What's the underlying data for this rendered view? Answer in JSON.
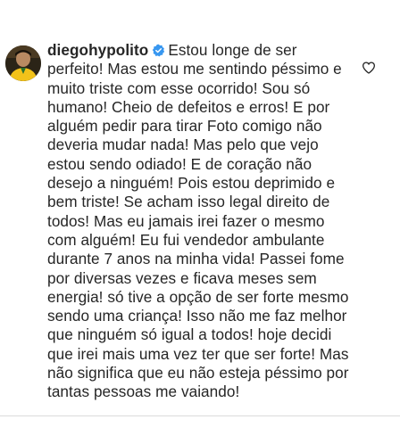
{
  "comment": {
    "username": "diegohypolito",
    "verified_icon": "verified-badge-icon",
    "verified_color": "#3897f0",
    "text": "Estou longe de ser perfeito! Mas estou me sentindo péssimo e muito triste com esse ocorrido! Sou só humano! Cheio de defeitos e erros! E por alguém pedir para tirar Foto comigo não deveria mudar nada! Mas pelo que vejo estou sendo odiado! E de coração não desejo a ninguém! Pois estou deprimido e bem triste! Se acham isso legal direito de todos! Mas eu jamais irei fazer o mesmo com alguém! Eu fui vendedor ambulante durante 7 anos na minha vida! Passei fome por diversas vezes e ficava meses sem energia! só tive a opção de ser forte mesmo sendo uma criança! Isso não me faz melhor que ninguém só igual a todos! hoje decidi que irei mais uma vez ter que ser forte! Mas não significa que eu não esteja péssimo por tantas pessoas me vaiando!",
    "like_icon": "heart-outline-icon"
  }
}
